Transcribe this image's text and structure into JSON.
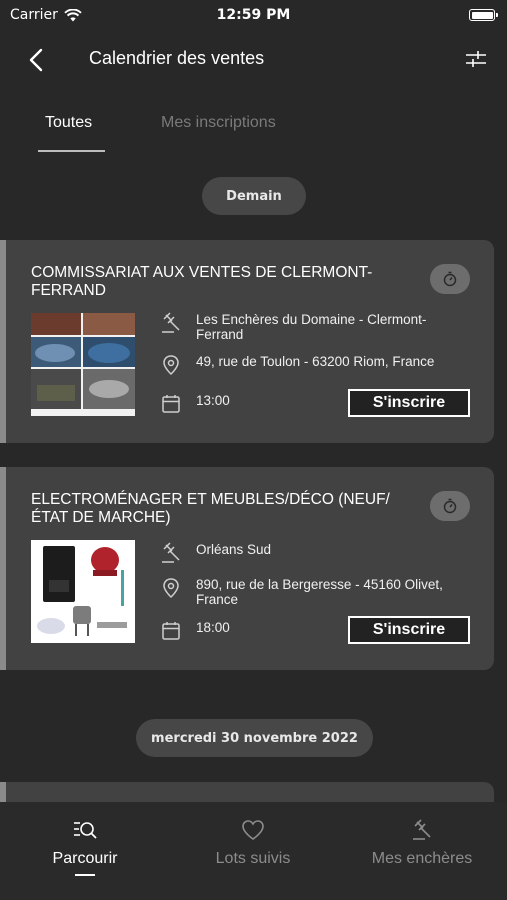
{
  "status_bar": {
    "carrier": "Carrier",
    "time": "12:59 PM"
  },
  "nav": {
    "title": "Calendrier des ventes"
  },
  "tabs": [
    {
      "label": "Toutes",
      "active": true
    },
    {
      "label": "Mes inscriptions",
      "active": false
    }
  ],
  "groups": [
    {
      "date_label": "Demain",
      "sales": [
        {
          "title": "COMMISSARIAT AUX VENTES DE CLERMONT-FERRAND",
          "auctioneer": "Les Enchères du Domaine - Clermont-Ferrand",
          "address": "49, rue de Toulon  - 63200 Riom, France",
          "time": "13:00",
          "register_label": "S'inscrire"
        },
        {
          "title": "ELECTROMÉNAGER ET MEUBLES/DÉCO (NEUF/ ÉTAT DE MARCHE)",
          "auctioneer": "Orléans Sud",
          "address": "890, rue de la Bergeresse - 45160  Olivet, France",
          "time": "18:00",
          "register_label": "S'inscrire"
        }
      ]
    },
    {
      "date_label": "mercredi 30 novembre 2022",
      "sales": []
    }
  ],
  "bottom_tabs": [
    {
      "label": "Parcourir",
      "icon": "browse-search-icon",
      "active": true
    },
    {
      "label": "Lots suivis",
      "icon": "heart-icon",
      "active": false
    },
    {
      "label": "Mes enchères",
      "icon": "gavel-icon",
      "active": false
    }
  ],
  "colors": {
    "background": "#282828",
    "card": "#424242",
    "pill": "#474747",
    "accent_border": "#8b8b8b"
  }
}
